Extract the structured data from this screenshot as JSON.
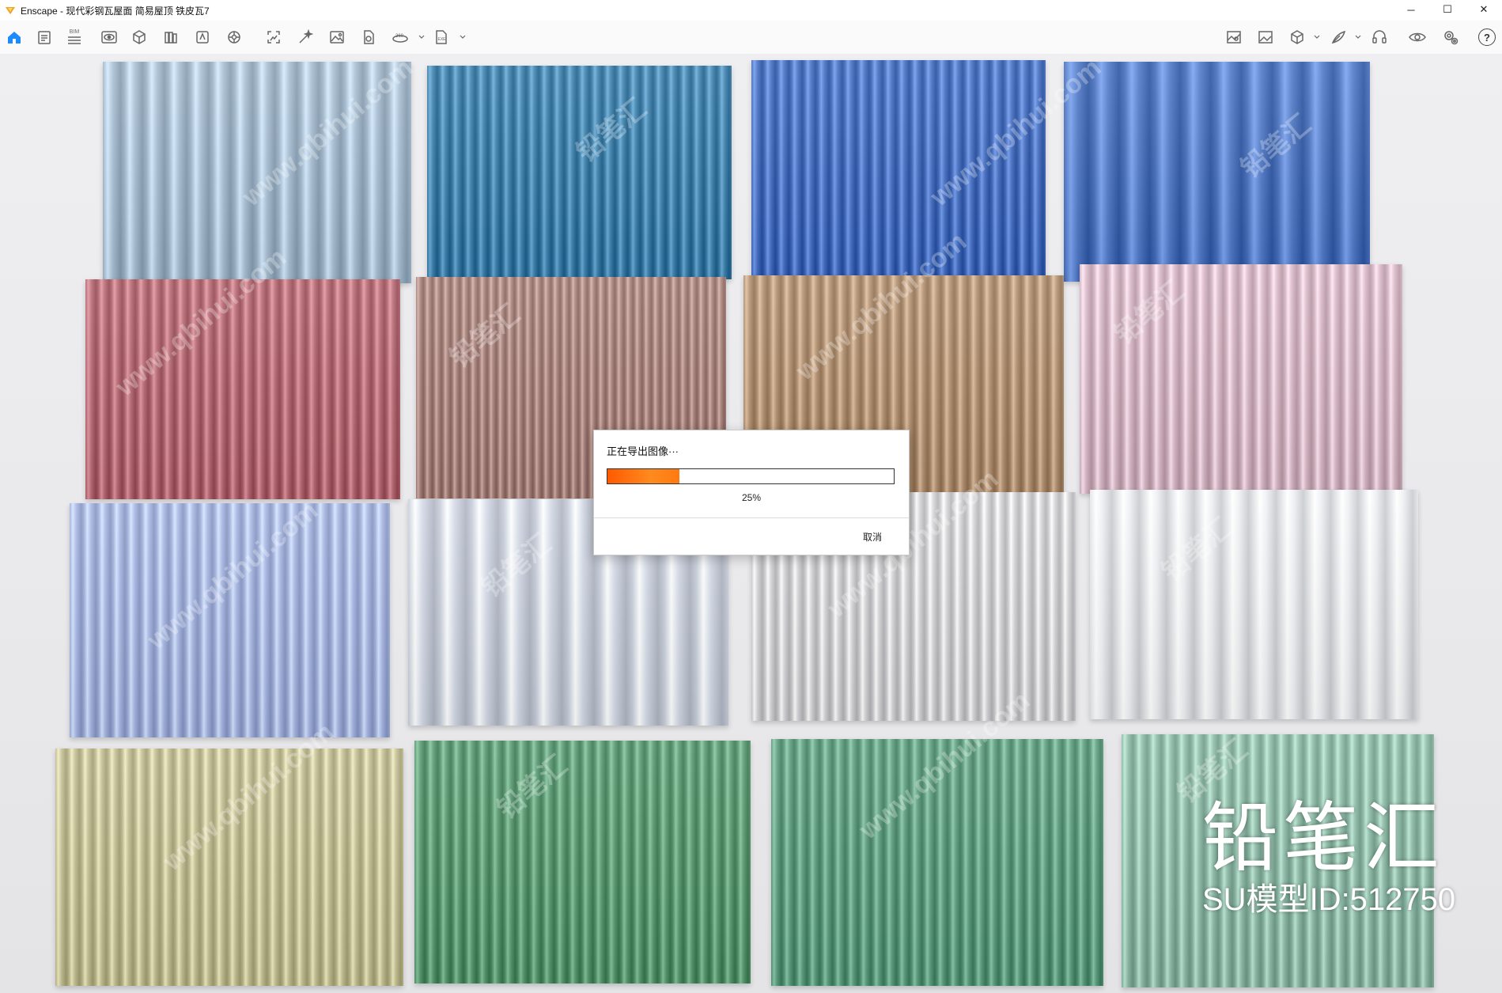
{
  "window": {
    "title": "Enscape - 现代彩钢瓦屋面 简易屋顶 铁皮瓦7",
    "controls": {
      "minimize": "─",
      "maximize": "☐",
      "close": "✕"
    }
  },
  "toolbar": {
    "bim_label": "BIM",
    "help_label": "?",
    "icons": [
      "home-icon",
      "document-icon",
      "bim-icon",
      "eye-icon",
      "cube-icon",
      "library-icon",
      "asset-icon",
      "settings-wheel-icon",
      "screenshot-icon",
      "magic-wand-icon",
      "image-icon",
      "export-icon",
      "panorama-360-icon",
      "exe-export-icon",
      "map-icon",
      "gallery-icon",
      "box-view-icon",
      "feather-icon",
      "headset-icon",
      "visibility-icon",
      "gear-icon",
      "help-icon"
    ]
  },
  "colors": {
    "accent": "#0a84ff",
    "progress": "#ff6a00"
  },
  "dialog": {
    "title": "正在导出图像···",
    "progress_percent": 25,
    "progress_text": "25%",
    "cancel_label": "取消"
  },
  "watermark": {
    "text": "www.qbihui.com",
    "text_cn": "铅笔汇",
    "brand_name": "铅笔汇",
    "model_id": "SU模型ID:512750"
  },
  "panels": [
    {
      "color": "#a9c0d4",
      "ribs": 14
    },
    {
      "color": "#3e82ae",
      "ribs": 24
    },
    {
      "color": "#4670c4",
      "ribs": 22
    },
    {
      "color": "#4f78c6",
      "ribs": 10
    },
    {
      "color": "#b86a74",
      "ribs": 24
    },
    {
      "color": "#ab857e",
      "ribs": 34
    },
    {
      "color": "#b59373",
      "ribs": 24
    },
    {
      "color": "#dcbcc9",
      "ribs": 22
    },
    {
      "color": "#a9b9e6",
      "ribs": 22
    },
    {
      "color": "#d3d9e6",
      "ribs": 10
    },
    {
      "color": "#d8d8da",
      "ribs": 24
    },
    {
      "color": "#eef0f3",
      "ribs": 12
    },
    {
      "color": "#c6c296",
      "ribs": 26
    },
    {
      "color": "#5a9b72",
      "ribs": 26
    },
    {
      "color": "#5f9f80",
      "ribs": 26
    },
    {
      "color": "#92bfab",
      "ribs": 22
    }
  ]
}
